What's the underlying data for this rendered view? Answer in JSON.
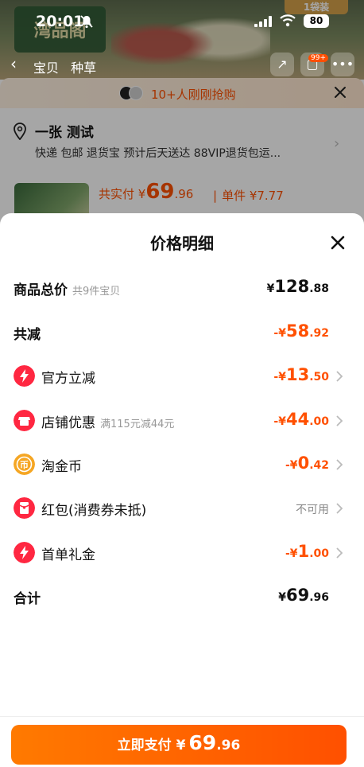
{
  "status_bar": {
    "time": "20:01",
    "battery": "80"
  },
  "background_page": {
    "brand_text": "湾品阁",
    "corner_tag": "1袋装",
    "nav_tabs": [
      "宝贝",
      "种草"
    ],
    "cart_badge": "99+",
    "banner_text": "10+人刚刚抢购",
    "address_name": "一张 测试",
    "address_sub": "快递 包邮 退货宝 预计后天送达 88VIP退货包运...",
    "actual_pay_label": "共实付 ¥",
    "actual_pay_int": "69",
    "actual_pay_dec": ".96",
    "unit_price": "单件 ¥7.77"
  },
  "popup": {
    "title": "价格明细",
    "rows": [
      {
        "label": "商品总价",
        "note": "共9件宝贝",
        "prefix": "¥",
        "int": "128",
        "dec": ".88",
        "color": "#111111"
      },
      {
        "label": "共减",
        "note": "",
        "prefix": "-¥",
        "int": "58",
        "dec": ".92",
        "color": "#ff5000"
      },
      {
        "label": "官方立减",
        "note": "",
        "prefix": "-¥",
        "int": "13",
        "dec": ".50",
        "color": "#ff5000"
      },
      {
        "label": "店铺优惠",
        "note": "满115元减44元",
        "prefix": "-¥",
        "int": "44",
        "dec": ".00",
        "color": "#ff5000"
      },
      {
        "label": "淘金币",
        "note": "",
        "prefix": "-¥",
        "int": "0",
        "dec": ".42",
        "color": "#ff5000"
      },
      {
        "label": "红包(消费券未抵)",
        "note": "",
        "status": "不可用"
      },
      {
        "label": "首单礼金",
        "note": "",
        "prefix": "-¥",
        "int": "1",
        "dec": ".00",
        "color": "#ff5000"
      },
      {
        "label": "合计",
        "note": "",
        "prefix": "¥",
        "int": "69",
        "dec": ".96",
        "color": "#111111"
      }
    ]
  },
  "pay_button": {
    "label": "立即支付 ¥",
    "int": "69",
    "dec": ".96"
  },
  "colors": {
    "accent": "#ff5000",
    "accent_light": "#ff7a00",
    "red_icon": "#ff2741",
    "gold_icon": "#f5a623"
  },
  "icons": {
    "official_discount": "lightning-icon",
    "shop_discount": "shop-icon",
    "taobao_coin": "coin-icon",
    "red_packet": "red-packet-icon",
    "first_order": "lightning-icon"
  }
}
